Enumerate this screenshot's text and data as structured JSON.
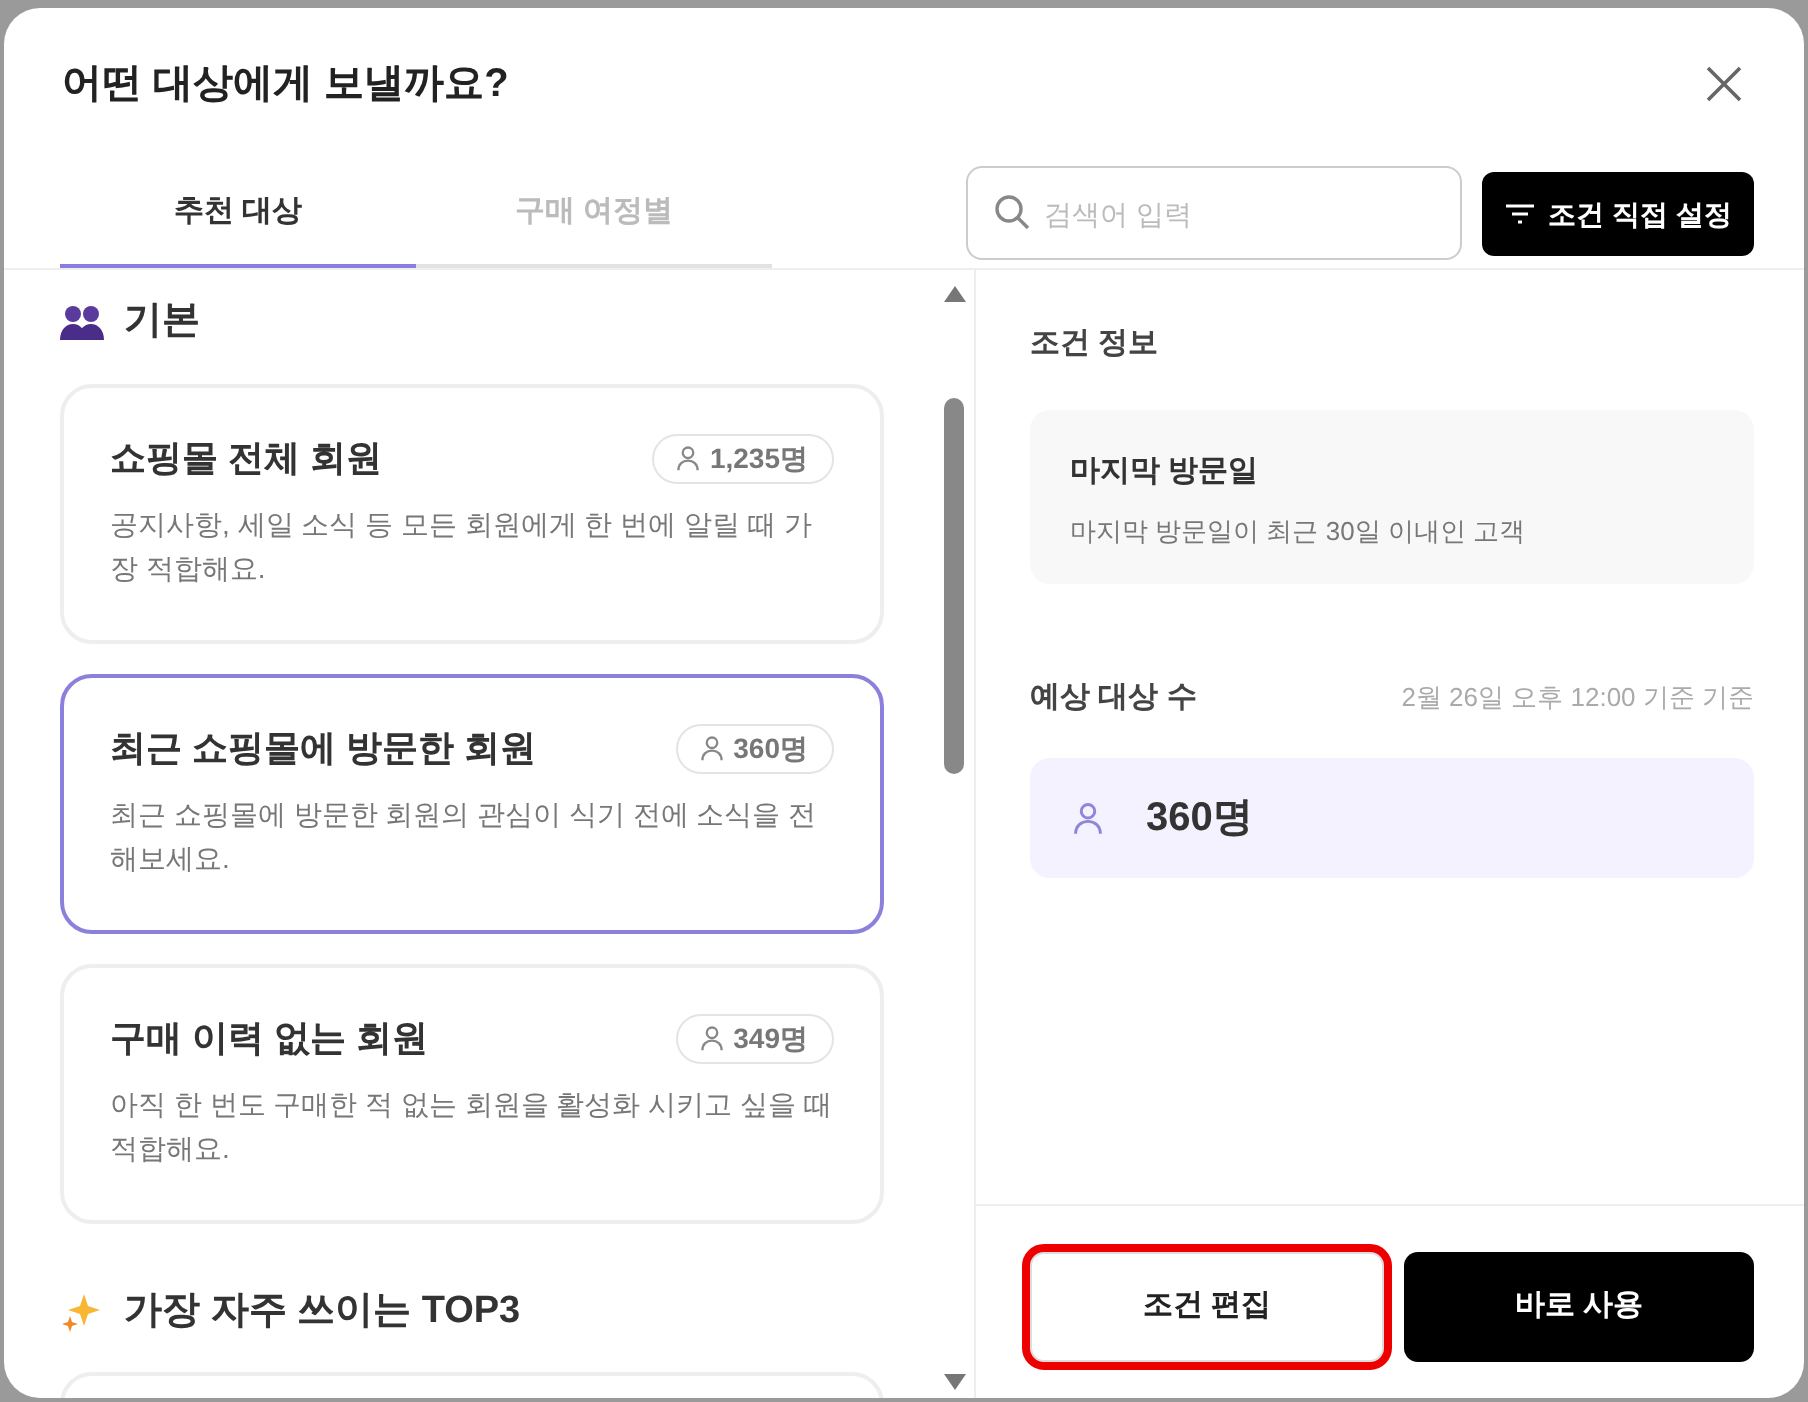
{
  "dialog": {
    "title": "어떤 대상에게 보낼까요?"
  },
  "tabs": [
    {
      "label": "추천 대상",
      "selected": true
    },
    {
      "label": "구매 여정별",
      "selected": false
    }
  ],
  "search": {
    "placeholder": "검색어 입력"
  },
  "filter_button": {
    "label": "조건 직접 설정"
  },
  "sections": [
    {
      "title": "기본",
      "items": [
        {
          "name": "쇼핑몰 전체 회원",
          "count": "1,235명",
          "description": "공지사항, 세일 소식 등 모든 회원에게 한 번에 알릴 때 가장 적합해요.",
          "selected": false
        },
        {
          "name": "최근 쇼핑몰에 방문한 회원",
          "count": "360명",
          "description": "최근 쇼핑몰에 방문한 회원의 관심이 식기 전에 소식을 전해보세요.",
          "selected": true
        },
        {
          "name": "구매 이력 없는 회원",
          "count": "349명",
          "description": "아직 한 번도 구매한 적 없는 회원을 활성화 시키고 싶을 때 적합해요.",
          "selected": false
        }
      ]
    },
    {
      "title": "가장 자주 쓰이는 TOP3",
      "more_below": true
    }
  ],
  "condition_info": {
    "heading": "조건 정보",
    "name": "마지막 방문일",
    "description": "마지막 방문일이 최근 30일 이내인 고객"
  },
  "estimate": {
    "heading": "예상 대상 수",
    "timestamp": "2월 26일 오후 12:00 기준 기준",
    "count": "360명"
  },
  "footer_buttons": [
    {
      "label": "조건 편집",
      "kind": "outline",
      "highlighted": true
    },
    {
      "label": "바로 사용",
      "kind": "solid",
      "highlighted": false
    }
  ]
}
